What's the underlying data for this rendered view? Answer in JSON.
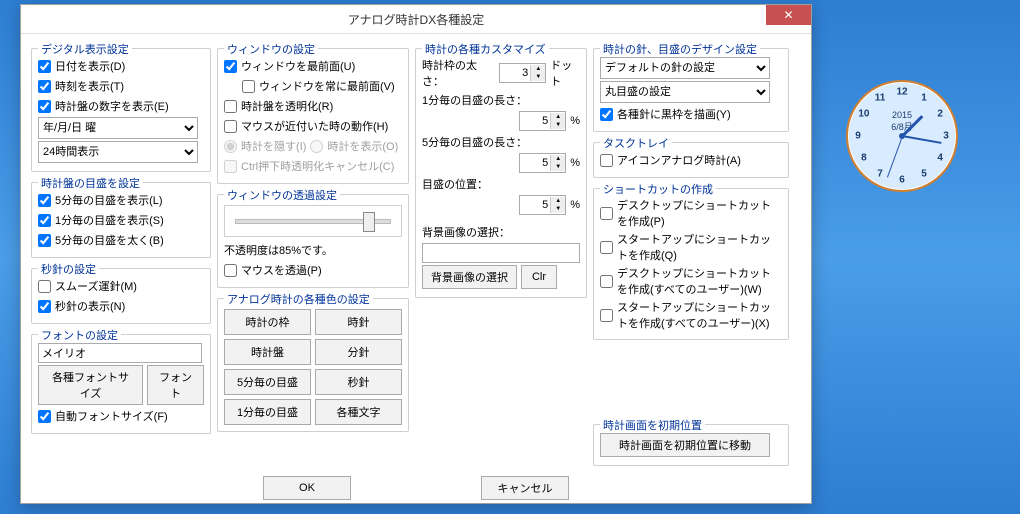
{
  "window": {
    "title": "アナログ時計DX各種設定",
    "close_glyph": "✕"
  },
  "digital": {
    "group": "デジタル表示設定",
    "show_date": "日付を表示(D)",
    "show_time": "時刻を表示(T)",
    "show_numbers": "時計盤の数字を表示(E)",
    "date_format": "年/月/日 曜",
    "hour_format": "24時間表示"
  },
  "ticks": {
    "group": "時計盤の目盛を設定",
    "show5": "5分毎の目盛を表示(L)",
    "show1": "1分毎の目盛を表示(S)",
    "bold5": "5分毎の目盛を太く(B)"
  },
  "second_hand": {
    "group": "秒針の設定",
    "smooth": "スムーズ運針(M)",
    "show": "秒針の表示(N)"
  },
  "font": {
    "group": "フォントの設定",
    "name": "メイリオ",
    "btn_sizes": "各種フォントサイズ",
    "btn_font": "フォント",
    "auto": "自動フォントサイズ(F)"
  },
  "win": {
    "group": "ウィンドウの設定",
    "topmost": "ウィンドウを最前面(U)",
    "always_topmost": "ウィンドウを常に最前面(V)",
    "transparent_face": "時計盤を透明化(R)",
    "mouse_near": "マウスが近付いた時の動作(H)",
    "hide_clock": "時計を隠す(I)",
    "show_clock": "時計を表示(O)",
    "ctrl_cancel": "Ctrl押下時透明化キャンセル(C)"
  },
  "opacity": {
    "group": "ウィンドウの透過設定",
    "status_prefix": "不透明度は",
    "status_value": "85%",
    "status_suffix": "です。",
    "mouse_trans": "マウスを透過(P)"
  },
  "colors": {
    "group": "アナログ時計の各種色の設定",
    "frame": "時計の枠",
    "hour_hand": "時針",
    "face": "時計盤",
    "minute_hand": "分針",
    "tick5": "5分毎の目盛",
    "second_hand": "秒針",
    "tick1": "1分毎の目盛",
    "texts": "各種文字"
  },
  "custom": {
    "group": "時計の各種カスタマイズ",
    "frame_width_label": "時計枠の太さ：",
    "frame_width": "3",
    "frame_unit": "ドット",
    "len1_label": "1分毎の目盛の長さ：",
    "len1": "5",
    "len5_label": "5分毎の目盛の長さ：",
    "len5": "5",
    "pos_label": "目盛の位置：",
    "pos": "5",
    "percent": "%",
    "bg_label": "背景画像の選択：",
    "bg_value": "",
    "btn_select_bg": "背景画像の選択",
    "btn_clear": "Clr"
  },
  "design": {
    "group": "時計の針、目盛のデザイン設定",
    "hand_preset": "デフォルトの針の設定",
    "tick_preset": "丸目盛の設定",
    "black_outline": "各種針に黒枠を描画(Y)"
  },
  "tray": {
    "group": "タスクトレイ",
    "icon_analog": "アイコンアナログ時計(A)"
  },
  "shortcuts": {
    "group": "ショートカットの作成",
    "desktop": "デスクトップにショートカットを作成(P)",
    "startup": "スタートアップにショートカットを作成(Q)",
    "desktop_all": "デスクトップにショートカットを作成(すべてのユーザー)(W)",
    "startup_all": "スタートアップにショートカットを作成(すべてのユーザー)(X)"
  },
  "reset": {
    "group": "時計画面を初期位置",
    "btn": "時計画面を初期位置に移動"
  },
  "footer": {
    "ok": "OK",
    "cancel": "キャンセル"
  },
  "clock": {
    "year": "2015",
    "date": "6/8月",
    "nums": [
      "12",
      "1",
      "2",
      "3",
      "4",
      "5",
      "6",
      "7",
      "8",
      "9",
      "10",
      "11"
    ]
  }
}
